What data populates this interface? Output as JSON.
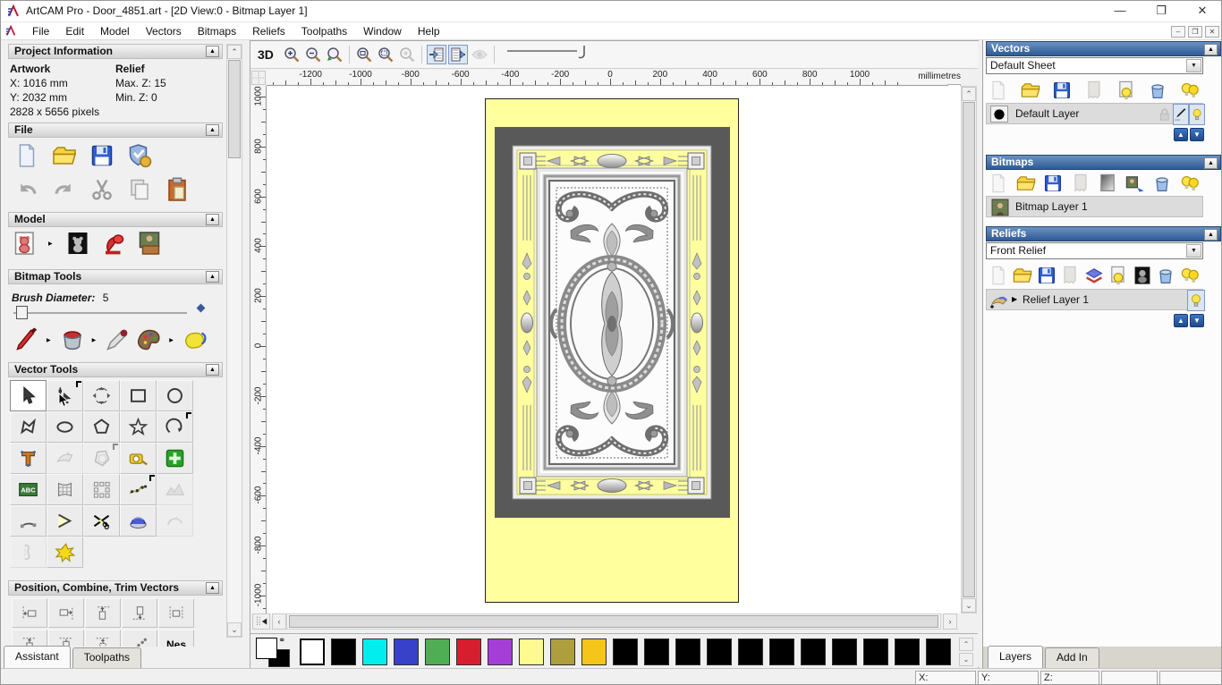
{
  "window": {
    "title": "ArtCAM Pro - Door_4851.art - [2D View:0 - Bitmap Layer 1]"
  },
  "menu": {
    "items": [
      "File",
      "Edit",
      "Model",
      "Vectors",
      "Bitmaps",
      "Reliefs",
      "Toolpaths",
      "Window",
      "Help"
    ]
  },
  "colors": {
    "header_blue": "#2e5a94",
    "page_yellow": "#ffff9e",
    "mat_gray": "#595959"
  },
  "assistant": {
    "project_info": {
      "title": "Project Information",
      "artwork_label": "Artwork",
      "relief_label": "Relief",
      "x": "X: 1016 mm",
      "y": "Y: 2032 mm",
      "pixels": "2828 x 5656 pixels",
      "max_z": "Max. Z: 15",
      "min_z": "Min. Z: 0"
    },
    "file_section": {
      "title": "File",
      "row1": [
        "new-model",
        "open-file",
        "save-model",
        "options"
      ],
      "row2": [
        "undo",
        "redo",
        "cut",
        "copy",
        "paste"
      ]
    },
    "model_section": {
      "title": "Model",
      "row": [
        {
          "name": "set-model-size",
          "arrow": true
        },
        "adjust-model",
        "lighting",
        "texture-relief"
      ]
    },
    "bitmap_tools": {
      "title": "Bitmap Tools",
      "brush_label": "Brush Diameter:",
      "brush_value": "5",
      "row": [
        {
          "name": "paint-brush",
          "arrow": true
        },
        {
          "name": "flood-fill",
          "arrow": true
        },
        "colour-picker",
        {
          "name": "palette",
          "arrow": true
        },
        "sponge"
      ]
    },
    "vector_tools": {
      "title": "Vector Tools",
      "abc_label": "ABC",
      "tools": [
        {
          "name": "select",
          "state": "active"
        },
        {
          "name": "node-editing",
          "pin": true
        },
        {
          "name": "transform"
        },
        {
          "name": "create-rectangle"
        },
        {
          "name": "create-circle"
        },
        {
          "name": "create-polyline"
        },
        {
          "name": "create-ellipse"
        },
        {
          "name": "create-polygon"
        },
        {
          "name": "create-star"
        },
        {
          "name": "create-arc",
          "pin": true
        },
        {
          "name": "create-text"
        },
        {
          "name": "wrap-text",
          "state": "disabled"
        },
        {
          "name": "offset",
          "state": "disabled",
          "pin": true
        },
        {
          "name": "measure"
        },
        {
          "name": "snap-grid"
        },
        {
          "name": "text-block"
        },
        {
          "name": "envelope-distort"
        },
        {
          "name": "block-copy"
        },
        {
          "name": "copy-along-curve",
          "pin": true
        },
        {
          "name": "unwrap",
          "state": "disabled"
        },
        {
          "name": "arc-fit"
        },
        {
          "name": "bisector"
        },
        {
          "name": "trim-vectors"
        },
        {
          "name": "extrude"
        },
        {
          "name": "stitch",
          "state": "disabled"
        },
        {
          "name": "profile",
          "state": "disabled"
        },
        {
          "name": "fillet"
        }
      ]
    },
    "position_section": {
      "title": "Position, Combine, Trim Vectors",
      "nes": "Nes",
      "row1": [
        "align-left",
        "align-right",
        "align-top",
        "align-bottom",
        "align-centre"
      ],
      "row2": [
        "align-h1",
        "align-h2",
        "align-h3",
        "spread",
        "nesting"
      ]
    },
    "tabs": [
      {
        "label": "Assistant",
        "active": true
      },
      {
        "label": "Toolpaths",
        "active": false
      }
    ]
  },
  "view": {
    "toolbar": {
      "btn_3d": "3D",
      "icons": [
        "zoom-in",
        "zoom-out",
        "zoom-previous",
        "sep",
        "zoom-scale",
        "zoom-fit",
        {
          "name": "zoom-object",
          "state": "disabled"
        },
        "sep",
        {
          "name": "previous-bitmap",
          "state": "pressed"
        },
        {
          "name": "next-bitmap",
          "state": "pressed"
        },
        {
          "name": "toggle-preview",
          "state": "disabled"
        },
        "sep"
      ]
    },
    "ruler": {
      "unit": "millimetres",
      "h_ticks": [
        -1200,
        -1000,
        -800,
        -600,
        -400,
        -200,
        0,
        200,
        400,
        600,
        800,
        1000
      ],
      "v_ticks": [
        1000,
        800,
        600,
        400,
        200,
        0,
        -200,
        -400,
        -600,
        -800,
        -1000
      ]
    }
  },
  "right": {
    "vectors": {
      "title": "Vectors",
      "sheet": "Default Sheet",
      "layer": "Default Layer",
      "icons": [
        {
          "name": "new-sheet",
          "state": "disabled"
        },
        "open-folder",
        "save",
        {
          "name": "merge",
          "state": "disabled"
        },
        "toggle-visibility-page",
        "delete",
        "toggle-all-bulbs"
      ],
      "layer_buttons": [
        {
          "name": "lock",
          "state": "disabled"
        },
        {
          "name": "edit-pen",
          "state": "pressed"
        },
        {
          "name": "bulb-on",
          "state": "pressed"
        }
      ]
    },
    "bitmaps": {
      "title": "Bitmaps",
      "layer": "Bitmap Layer 1",
      "icons": [
        {
          "name": "new-page",
          "state": "disabled"
        },
        "open-folder",
        "save",
        {
          "name": "merge",
          "state": "disabled"
        },
        "gradient-page",
        "bitmap-to-vector",
        "delete",
        "toggle-all-bulbs"
      ]
    },
    "reliefs": {
      "title": "Reliefs",
      "relief": "Front Relief",
      "layer": "Relief Layer 1",
      "icons": [
        {
          "name": "new-page",
          "state": "disabled"
        },
        "open-folder",
        "save",
        {
          "name": "merge",
          "state": "disabled"
        },
        "relief-stack",
        "toggle-visibility-page",
        "greyscale-relief",
        "delete",
        "toggle-all-bulbs"
      ],
      "layer_buttons": [
        {
          "name": "bulb-on",
          "state": "pressed"
        }
      ]
    },
    "tabs": [
      {
        "label": "Layers",
        "active": true
      },
      {
        "label": "Add In",
        "active": false
      }
    ]
  },
  "palette": {
    "colors": [
      "#FFFFFF",
      "#000000",
      "#00EEEE",
      "#3742C9",
      "#4FAE54",
      "#D51F2E",
      "#A53ED6",
      "#FDFB8F",
      "#AD9F3D",
      "#F6C51C",
      "#000000",
      "#000000",
      "#000000",
      "#000000",
      "#000000",
      "#000000",
      "#000000",
      "#000000",
      "#000000",
      "#000000",
      "#000000"
    ]
  },
  "statusbar": {
    "fields": [
      {
        "label": "X:"
      },
      {
        "label": "Y:"
      },
      {
        "label": "Z:"
      },
      {
        "label": ""
      },
      {
        "label": ""
      }
    ]
  }
}
